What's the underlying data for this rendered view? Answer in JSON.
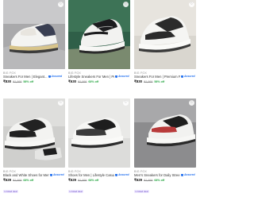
{
  "products": [
    {
      "brand": "BIG FOX",
      "title": "Sneakers For Men | Elegant...",
      "price": "₹830",
      "mrp": "₹1,999",
      "discount": "58% off",
      "assured": "Assured",
      "tag": ""
    },
    {
      "brand": "BIG FOX",
      "title": "Lifestyle Sneakers For Men | Pre...",
      "price": "₹630",
      "mrp": "₹1,999",
      "discount": "68% off",
      "assured": "Assured",
      "tag": ""
    },
    {
      "brand": "BIG FOX",
      "title": "Sneakers For Men | Premium Fa...",
      "price": "₹830",
      "mrp": "₹1,999",
      "discount": "58% off",
      "assured": "Assured",
      "tag": ""
    },
    {
      "brand": "BIG FOX",
      "title": "Black and White Shoes for Men |...",
      "price": "₹629",
      "mrp": "₹1,999",
      "discount": "68% off",
      "assured": "Assured",
      "tag": "Limited deal"
    },
    {
      "brand": "BIG FOX",
      "title": "Shoes for Men | Lifestyle Casual...",
      "price": "₹629",
      "mrp": "₹1,999",
      "discount": "68% off",
      "assured": "Assured",
      "tag": "Limited deal"
    },
    {
      "brand": "BIG FOX",
      "title": "Men's Sneakers for Daily Stree...",
      "price": "₹629",
      "mrp": "₹1,999",
      "discount": "68% off",
      "assured": "Assured",
      "tag": "Limited deal"
    }
  ],
  "colors": {
    "discount": "#26a541",
    "assured": "#2874f0",
    "tag_text": "#6a4bc4",
    "tag_bg": "#efe9ff"
  },
  "icons": {
    "wishlist": "heart-icon",
    "assured": "assured-shield-icon"
  },
  "wishlist_glyph": "♡"
}
